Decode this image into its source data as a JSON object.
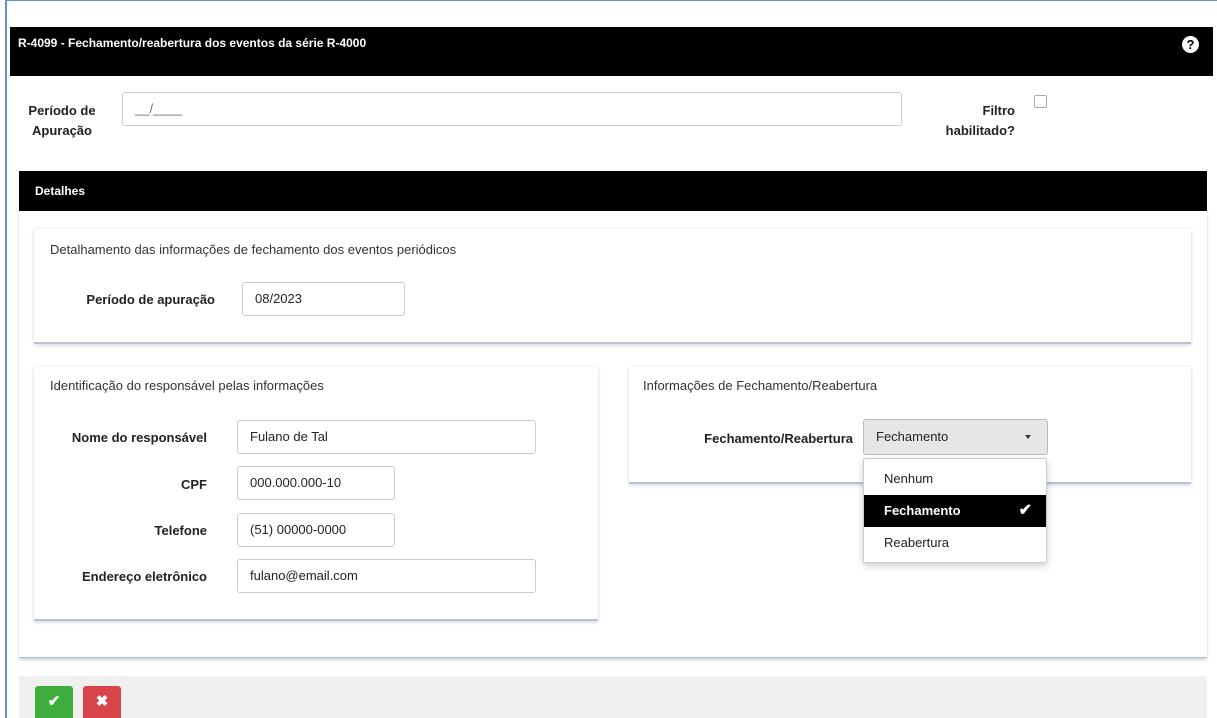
{
  "header": {
    "title": "R-4099 - Fechamento/reabertura dos eventos da série R-4000",
    "help_icon": "?"
  },
  "filters": {
    "periodo_label": "Período de Apuração",
    "periodo_placeholder": "__/____",
    "filtro_label": "Filtro habilitado?",
    "filtro_checked": false
  },
  "detalhes": {
    "title": "Detalhes",
    "fechamento_section": {
      "title": "Detalhamento das informações de fechamento dos eventos periódicos",
      "periodo_label": "Período de apuração",
      "periodo_value": "08/2023"
    },
    "responsavel_section": {
      "title": "Identificação do responsável pelas informações",
      "nome_label": "Nome do responsável",
      "nome_value": "Fulano de Tal",
      "cpf_label": "CPF",
      "cpf_value": "000.000.000-10",
      "telefone_label": "Telefone",
      "telefone_value": "(51) 00000-0000",
      "email_label": "Endereço eletrônico",
      "email_value": "fulano@email.com"
    },
    "reabertura_section": {
      "title": "Informações de Fechamento/Reabertura",
      "select_label": "Fechamento/Reabertura",
      "select_value": "Fechamento",
      "options": [
        "Nenhum",
        "Fechamento",
        "Reabertura"
      ],
      "selected_index": 1
    }
  },
  "footer": {
    "confirm_icon": "✔",
    "cancel_icon": "✖"
  },
  "colors": {
    "header_bg": "#000000",
    "confirm": "#3fae3f",
    "cancel": "#d9434a"
  }
}
